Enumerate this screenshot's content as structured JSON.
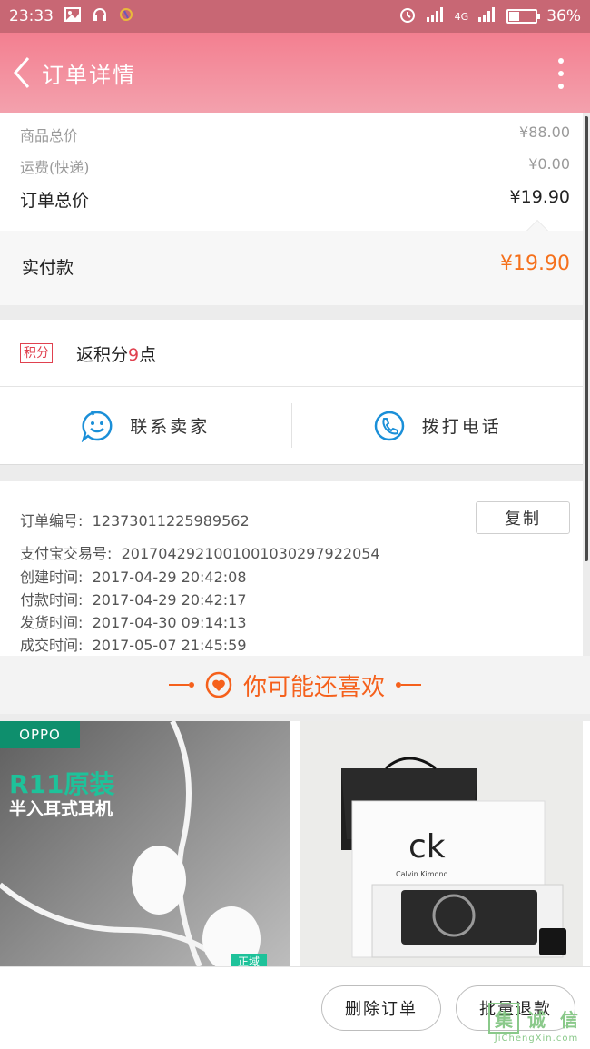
{
  "status_bar": {
    "time": "23:33",
    "network": "4G",
    "battery_percent": "36%",
    "battery_level": 0.36
  },
  "header": {
    "title": "订单详情"
  },
  "price_summary": {
    "goods_total_label": "商品总价",
    "goods_total_value": "¥88.00",
    "shipping_label": "运费(快递)",
    "shipping_value": "¥0.00",
    "order_total_label": "订单总价",
    "order_total_value": "¥19.90",
    "paid_label": "实付款",
    "paid_value": "¥19.90"
  },
  "points": {
    "badge": "积分",
    "text_before": "返积分",
    "amount": "9",
    "text_after": "点"
  },
  "contact": {
    "seller_label": "联系卖家",
    "phone_label": "拨打电话"
  },
  "order_info": {
    "order_no_label": "订单编号:",
    "order_no": "1237301122598956​2",
    "copy_label": "复制",
    "alipay_label": "支付宝交易号:",
    "alipay_no": "2017042921001001030297922054",
    "created_label": "创建时间:",
    "created": "2017-04-29 20:42:08",
    "paid_label": "付款时间:",
    "paid": "2017-04-29 20:42:17",
    "shipped_label": "发货时间:",
    "shipped": "2017-04-30 09:14:13",
    "completed_label": "成交时间:",
    "completed": "2017-05-07 21:45:59"
  },
  "recommend": {
    "title": "你可能还喜欢"
  },
  "products": [
    {
      "brand_tag": "OPPO",
      "headline": "R11原装",
      "subline": "半入耳式耳机",
      "corner_tag": "正域"
    },
    {
      "brand": "ck",
      "brand_sub": "Calvin Kimono"
    }
  ],
  "bottom_bar": {
    "delete_label": "删除订单",
    "refund_label": "批量退款"
  },
  "watermark": {
    "chars": [
      "集",
      "诚",
      "信"
    ],
    "url": "JiChengXin.com"
  },
  "colors": {
    "status_bar": "#c86774",
    "header_top": "#f37f90",
    "accent_orange": "#f5701b",
    "points_red": "#e0414f",
    "contact_blue": "#1a8fd8"
  }
}
